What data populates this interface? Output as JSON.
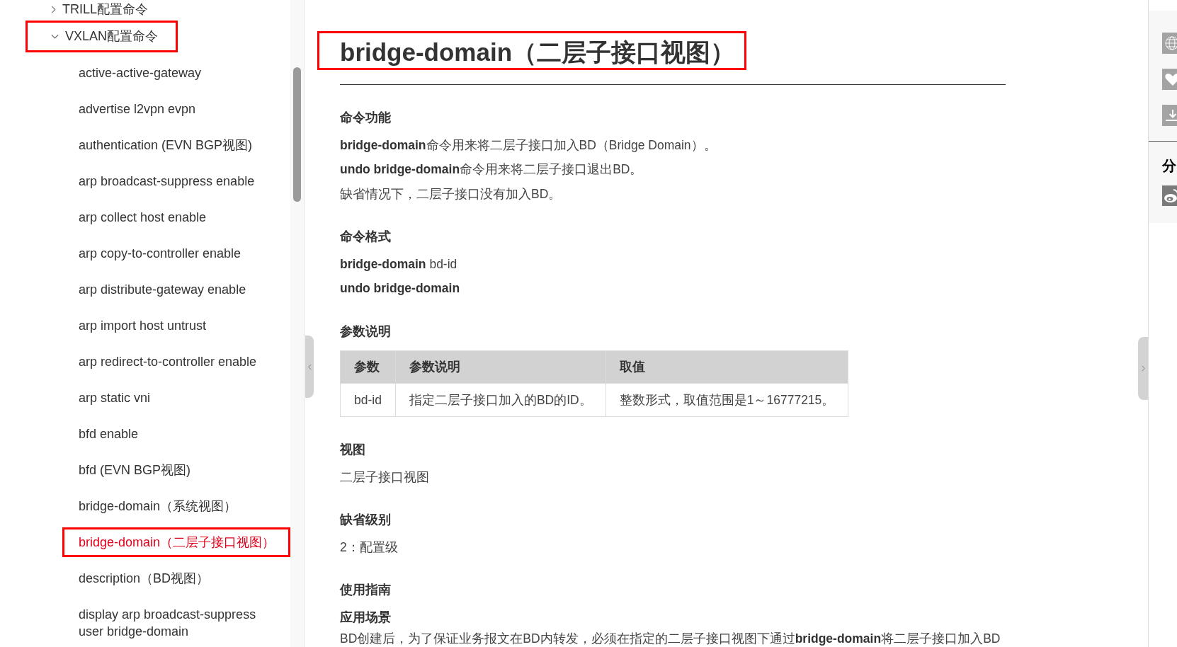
{
  "sidebar": {
    "items": [
      {
        "label": "TRILL配置命令",
        "expanded": false,
        "annotated": false
      },
      {
        "label": "VXLAN配置命令",
        "expanded": true,
        "annotated": true,
        "children": [
          {
            "label": "active-active-gateway",
            "selected": false,
            "annotated": false
          },
          {
            "label": "advertise l2vpn evpn",
            "selected": false,
            "annotated": false
          },
          {
            "label": "authentication (EVN BGP视图)",
            "selected": false,
            "annotated": false
          },
          {
            "label": "arp broadcast-suppress enable",
            "selected": false,
            "annotated": false
          },
          {
            "label": "arp collect host enable",
            "selected": false,
            "annotated": false
          },
          {
            "label": "arp copy-to-controller enable",
            "selected": false,
            "annotated": false
          },
          {
            "label": "arp distribute-gateway enable",
            "selected": false,
            "annotated": false
          },
          {
            "label": "arp import host untrust",
            "selected": false,
            "annotated": false
          },
          {
            "label": "arp redirect-to-controller enable",
            "selected": false,
            "annotated": false
          },
          {
            "label": "arp static vni",
            "selected": false,
            "annotated": false
          },
          {
            "label": "bfd enable",
            "selected": false,
            "annotated": false
          },
          {
            "label": "bfd (EVN BGP视图)",
            "selected": false,
            "annotated": false
          },
          {
            "label": "bridge-domain（系统视图）",
            "selected": false,
            "annotated": false
          },
          {
            "label": "bridge-domain（二层子接口视图）",
            "selected": true,
            "annotated": true
          },
          {
            "label": "description（BD视图）",
            "selected": false,
            "annotated": false
          },
          {
            "label": "display arp broadcast-suppress user bridge-domain",
            "selected": false,
            "annotated": false
          }
        ]
      }
    ]
  },
  "article": {
    "title": "bridge-domain（二层子接口视图）",
    "title_annotated": true,
    "blocks": [
      {
        "kind": "heading",
        "text": "命令功能"
      },
      {
        "kind": "paragraph",
        "text": "**bridge-domain**命令用来将二层子接口加入BD（Bridge Domain）。"
      },
      {
        "kind": "paragraph",
        "text": "**undo bridge-domain**命令用来将二层子接口退出BD。"
      },
      {
        "kind": "paragraph",
        "text": "缺省情况下，二层子接口没有加入BD。"
      },
      {
        "kind": "heading",
        "text": "命令格式"
      },
      {
        "kind": "paragraph",
        "text": "**bridge-domain** bd-id"
      },
      {
        "kind": "command",
        "text": "undo bridge-domain"
      },
      {
        "kind": "heading",
        "text": "参数说明"
      },
      {
        "kind": "table",
        "columns": [
          "参数",
          "参数说明",
          "取值"
        ],
        "rows": [
          [
            "bd-id",
            "指定二层子接口加入的BD的ID。",
            "整数形式，取值范围是1～16777215。"
          ]
        ]
      },
      {
        "kind": "heading",
        "text": "视图"
      },
      {
        "kind": "paragraph",
        "text": "二层子接口视图"
      },
      {
        "kind": "heading",
        "text": "缺省级别"
      },
      {
        "kind": "paragraph",
        "text": "2：配置级"
      },
      {
        "kind": "heading",
        "text": "使用指南"
      },
      {
        "kind": "subheading",
        "text": "应用场景"
      },
      {
        "kind": "paragraph",
        "text": "BD创建后，为了保证业务报文在BD内转发，必须在指定的二层子接口视图下通过**bridge-domain**将二层子接口加入BD"
      }
    ]
  },
  "share_panel": {
    "heading": "分"
  }
}
